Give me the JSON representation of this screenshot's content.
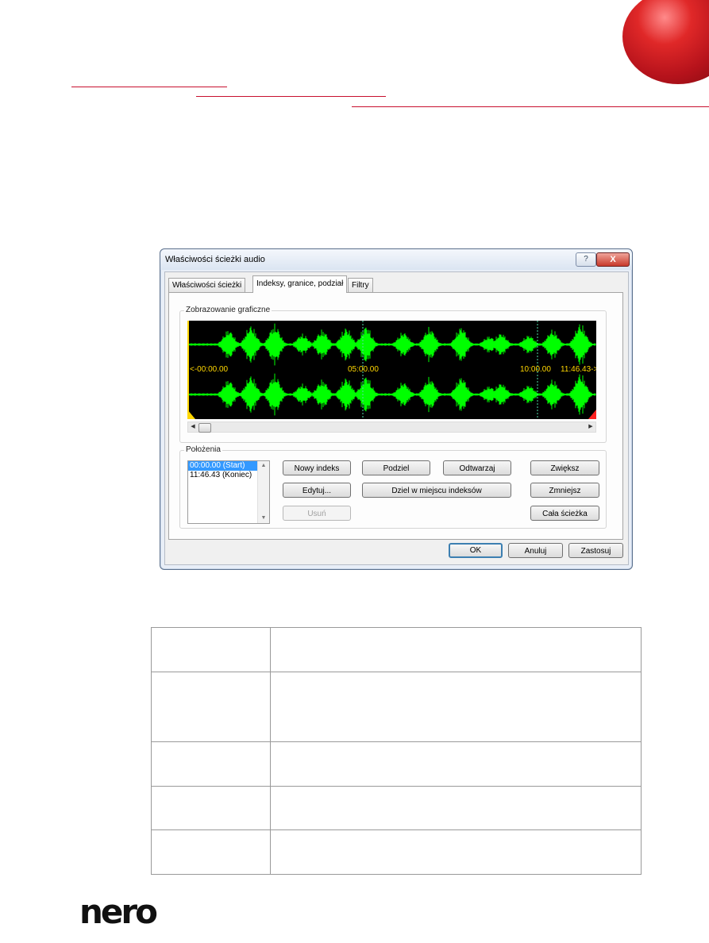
{
  "dialog": {
    "title": "Właściwości ścieżki audio",
    "help_label": "?",
    "close_label": "X",
    "tabs": [
      {
        "label": "Właściwości ścieżki"
      },
      {
        "label": "Indeksy, granice, podział"
      },
      {
        "label": "Filtry"
      }
    ],
    "graphic_group": {
      "label": "Zobrazowanie graficzne",
      "time_labels": [
        "<-00:00.00",
        "05:00.00",
        "10:00.00",
        "11:46.43->"
      ],
      "waveform_color": "#00ff00",
      "marker_color": "#ffd700",
      "end_marker_color": "#ff2020"
    },
    "positions_group": {
      "label": "Położenia",
      "list_items": [
        "00:00.00 (Start)",
        "11:46.43 (Koniec)"
      ],
      "selected_index": 0
    },
    "buttons": {
      "new_index": "Nowy indeks",
      "split": "Podziel",
      "play": "Odtwarzaj",
      "zoom_in": "Zwiększ",
      "edit": "Edytuj...",
      "split_at_indexes": "Dziel w miejscu indeksów",
      "zoom_out": "Zmniejsz",
      "delete": "Usuń",
      "whole_track": "Cała ścieżka"
    },
    "footer": {
      "ok": "OK",
      "cancel": "Anuluj",
      "apply": "Zastosuj"
    }
  },
  "logo": {
    "text": "nero"
  },
  "colors": {
    "brand_red": "#c8102e",
    "dialog_accent": "#3c7fb1"
  }
}
